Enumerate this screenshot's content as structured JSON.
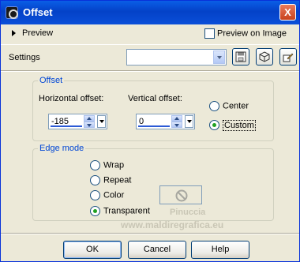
{
  "window": {
    "title": "Offset",
    "close_glyph": "X"
  },
  "header": {
    "preview_label": "Preview",
    "preview_on_image_label": "Preview on Image"
  },
  "settings": {
    "label": "Settings",
    "selected_value": ""
  },
  "offset": {
    "group_title": "Offset",
    "horizontal_label": "Horizontal offset:",
    "horizontal_value": "-185",
    "vertical_label": "Vertical offset:",
    "vertical_value": "0",
    "options": [
      "Center",
      "Custom"
    ],
    "selected": "Custom"
  },
  "edge_mode": {
    "group_title": "Edge mode",
    "options": [
      "Wrap",
      "Repeat",
      "Color",
      "Transparent"
    ],
    "selected": "Transparent"
  },
  "watermark": {
    "line1": "Pinuccia",
    "line2": "www.maldiregrafica.eu"
  },
  "buttons": {
    "ok": "OK",
    "cancel": "Cancel",
    "help": "Help"
  },
  "colors": {
    "title_bar": "#0a5ee6",
    "group_title": "#0046d5",
    "window_bg": "#ece9d8",
    "radio_check": "#21a121"
  }
}
